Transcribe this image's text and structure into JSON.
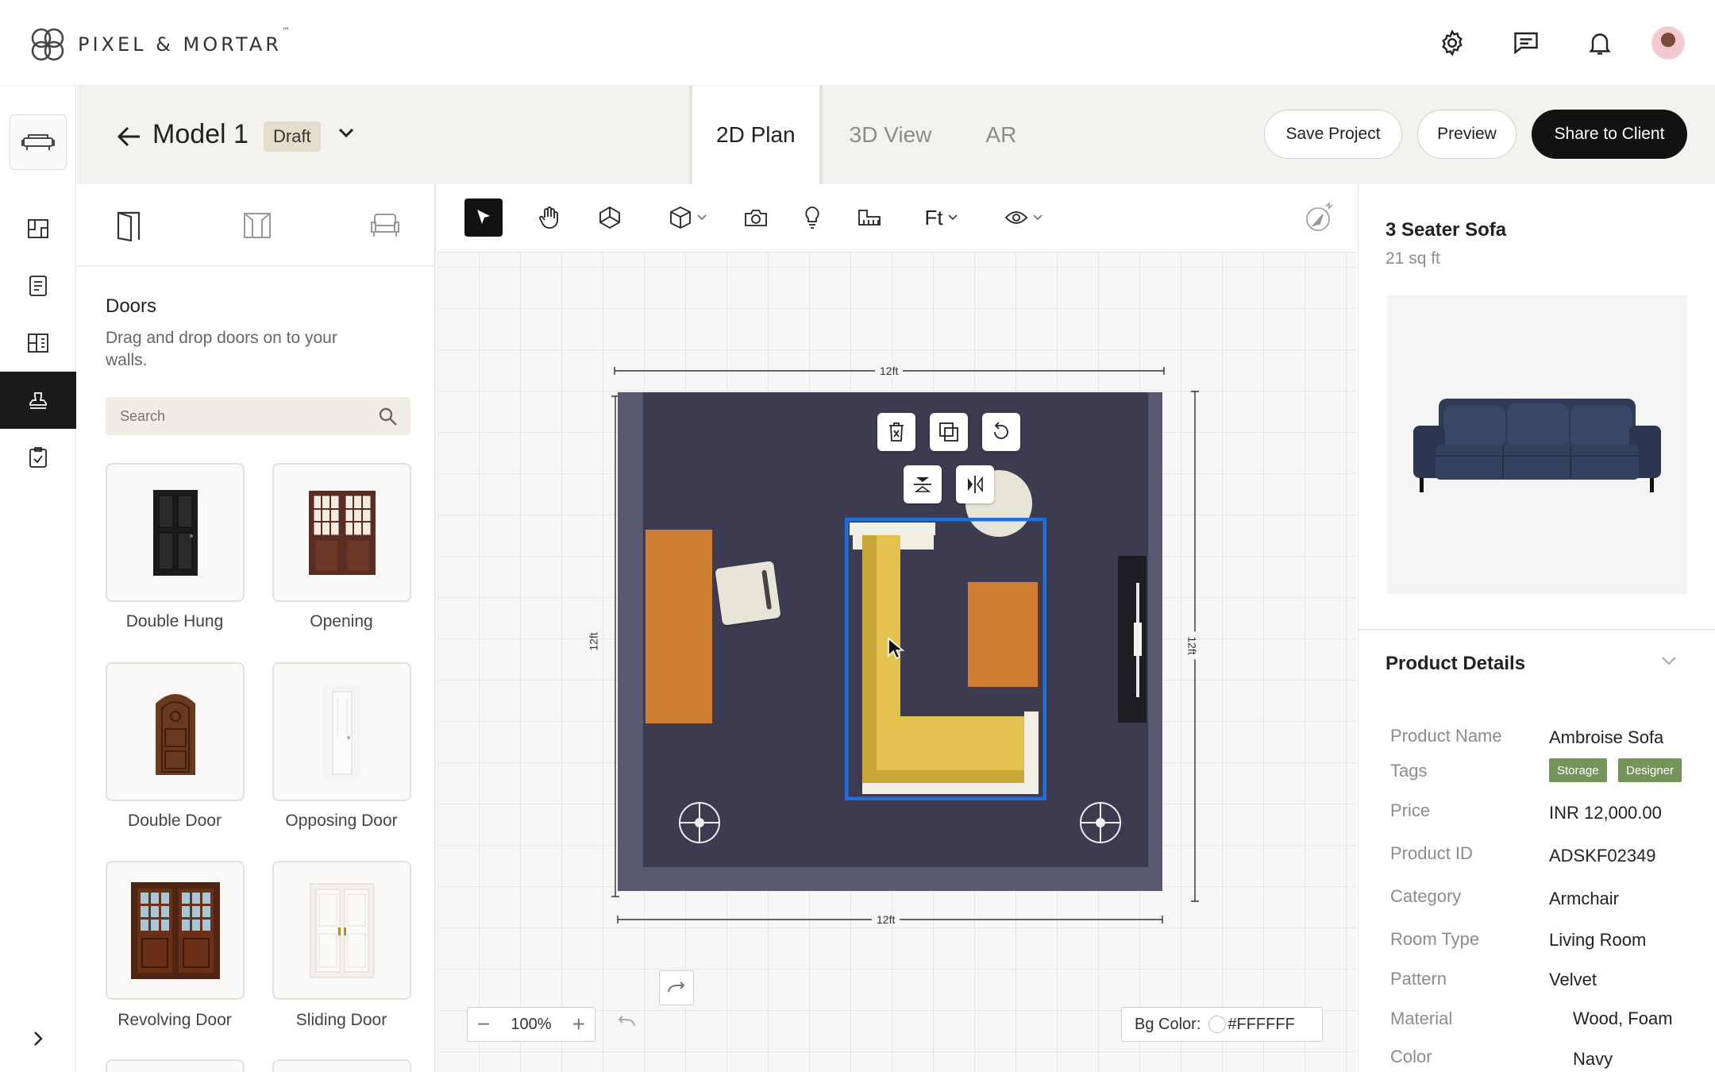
{
  "brand": {
    "name": "PIXEL & MORTAR",
    "tm": "™"
  },
  "header_icons": [
    "settings-gear-icon",
    "chat-message-icon",
    "notification-bell-icon"
  ],
  "project": {
    "back_icon": "arrow-left-icon",
    "title": "Model 1",
    "status": "Draft"
  },
  "view_tabs": [
    {
      "label": "2D Plan",
      "active": true
    },
    {
      "label": "3D View",
      "active": false
    },
    {
      "label": "AR",
      "active": false
    }
  ],
  "actions": {
    "save": "Save Project",
    "preview": "Preview",
    "share": "Share to Client"
  },
  "doors_panel": {
    "title": "Doors",
    "description": "Drag and drop doors on to your walls.",
    "search_placeholder": "Search",
    "items": [
      {
        "label": "Double Hung"
      },
      {
        "label": "Opening"
      },
      {
        "label": "Double Door"
      },
      {
        "label": "Opposing Door"
      },
      {
        "label": "Revolving Door"
      },
      {
        "label": "Sliding Door"
      }
    ]
  },
  "toolbar": {
    "unit": "Ft"
  },
  "floorplan": {
    "dimension_top": "12ft",
    "dimension_bottom": "12ft",
    "dimension_left": "12ft",
    "dimension_right": "12ft"
  },
  "zoom": {
    "value": "100%"
  },
  "bg_color": {
    "label": "Bg Color:",
    "value": "#FFFFFF"
  },
  "product": {
    "name": "3 Seater Sofa",
    "area": "21 sq ft",
    "details_title": "Product Details",
    "details": [
      {
        "key": "Product Name",
        "value": "Ambroise Sofa"
      },
      {
        "key": "Tags",
        "tags": [
          "Storage",
          "Designer"
        ]
      },
      {
        "key": "Price",
        "value": "INR 12,000.00"
      },
      {
        "key": "Product ID",
        "value": "ADSKF02349"
      },
      {
        "key": "Category",
        "value": "Armchair"
      },
      {
        "key": "Room Type",
        "value": "Living Room"
      },
      {
        "key": "Pattern",
        "value": "Velvet"
      },
      {
        "key": "Material",
        "value": "Wood, Foam"
      },
      {
        "key": "Color",
        "value": "Navy"
      }
    ]
  },
  "colors": {
    "accent_dark": "#121212",
    "room_floor": "#3c3b4f",
    "room_wall": "#585870",
    "sofa_yellow": "#e3c250",
    "furniture_orange": "#cf7d33",
    "selection_blue": "#1b6fe0",
    "tag_green": "#74955a"
  }
}
